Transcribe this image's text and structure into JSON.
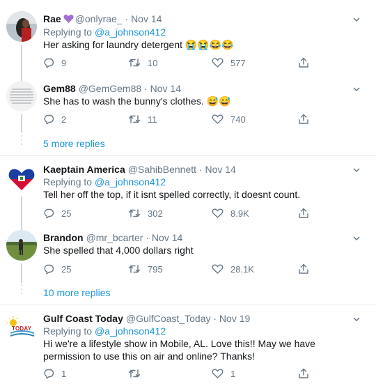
{
  "tweets": [
    {
      "name": "Rae",
      "handle": "@onlyrae_",
      "date": "Nov 14",
      "replying_prefix": "Replying to ",
      "replying_to": "@a_johnson412",
      "text": "Her  asking for laundry detergent 😭😭😂😂",
      "replies": "9",
      "retweets": "10",
      "likes": "577"
    },
    {
      "name": "Gem88",
      "handle": "@GemGem88",
      "date": "Nov 14",
      "text": "She has to wash the bunny's clothes. 😅😅",
      "replies": "2",
      "retweets": "11",
      "likes": "740"
    },
    {
      "name": "Kaeptain America",
      "handle": "@SahibBennett",
      "date": "Nov 14",
      "replying_prefix": "Replying to ",
      "replying_to": "@a_johnson412",
      "text": "Tell her off the top, if it isnt spelled correctly, it doesnt count.",
      "replies": "25",
      "retweets": "302",
      "likes": "8.9K"
    },
    {
      "name": "Brandon",
      "handle": "@mr_bcarter",
      "date": "Nov 14",
      "text": "She spelled that 4,000 dollars right",
      "replies": "25",
      "retweets": "795",
      "likes": "28.1K"
    },
    {
      "name": "Gulf Coast Today",
      "handle": "@GulfCoast_Today",
      "date": "Nov 19",
      "replying_prefix": "Replying to ",
      "replying_to": "@a_johnson412",
      "text": "Hi we're a lifestyle show in Mobile, AL. Love this!! May we have permission to use this on air and online? Thanks!",
      "replies": "1",
      "retweets": "",
      "likes": "1",
      "avatar_text": "TODAY"
    }
  ],
  "more_replies": [
    "5 more replies",
    "10 more replies"
  ],
  "colors": {
    "link": "#1b95e0",
    "muted": "#657786",
    "text": "#14171a",
    "divider": "#e6ecf0",
    "verified": "#a26fd6"
  },
  "icons": [
    "reply-icon",
    "retweet-icon",
    "like-icon",
    "share-icon",
    "chevron-down-icon",
    "purple-heart-icon"
  ]
}
